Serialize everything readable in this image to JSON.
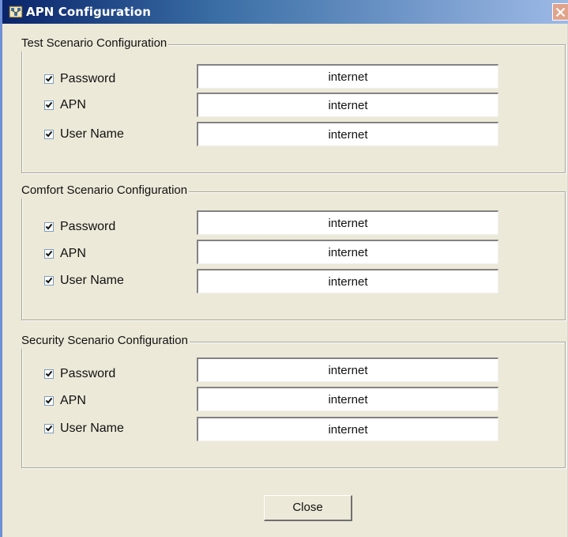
{
  "window": {
    "title": "APN Configuration",
    "icon": "network-icon",
    "close_icon": "close-icon"
  },
  "groups": [
    {
      "legend": "Test Scenario Configuration",
      "rows": [
        {
          "label": "Password",
          "checked": true,
          "value": "internet"
        },
        {
          "label": "APN",
          "checked": true,
          "value": "internet"
        },
        {
          "label": "User Name",
          "checked": true,
          "value": "internet"
        }
      ]
    },
    {
      "legend": "Comfort Scenario Configuration",
      "rows": [
        {
          "label": "Password",
          "checked": true,
          "value": "internet"
        },
        {
          "label": "APN",
          "checked": true,
          "value": "internet"
        },
        {
          "label": "User Name",
          "checked": true,
          "value": "internet"
        }
      ]
    },
    {
      "legend": "Security Scenario Configuration",
      "rows": [
        {
          "label": "Password",
          "checked": true,
          "value": "internet"
        },
        {
          "label": "APN",
          "checked": true,
          "value": "internet"
        },
        {
          "label": "User Name",
          "checked": true,
          "value": "internet"
        }
      ]
    }
  ],
  "footer": {
    "close_label": "Close"
  }
}
